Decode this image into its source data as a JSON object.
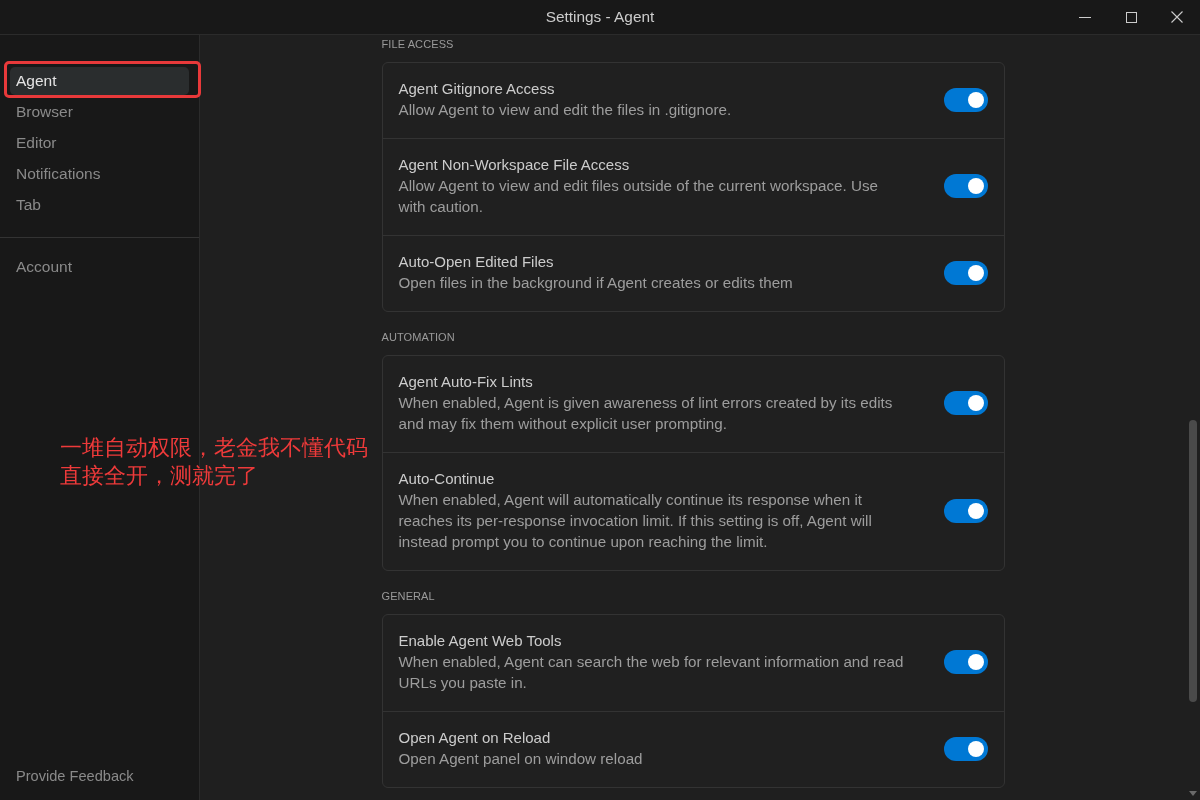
{
  "window": {
    "title": "Settings - Agent"
  },
  "sidebar": {
    "items": [
      {
        "label": "Agent",
        "selected": true,
        "circled": true
      },
      {
        "label": "Browser",
        "selected": false,
        "circled": false
      },
      {
        "label": "Editor",
        "selected": false,
        "circled": false
      },
      {
        "label": "Notifications",
        "selected": false,
        "circled": false
      },
      {
        "label": "Tab",
        "selected": false,
        "circled": false
      }
    ],
    "secondary_items": [
      {
        "label": "Account",
        "selected": false,
        "circled": false
      }
    ],
    "footer_link": "Provide Feedback"
  },
  "sections": [
    {
      "heading": "FILE ACCESS",
      "settings": [
        {
          "title": "Agent Gitignore Access",
          "description": "Allow Agent to view and edit the files in .gitignore.",
          "on": true
        },
        {
          "title": "Agent Non-Workspace File Access",
          "description": "Allow Agent to view and edit files outside of the current workspace. Use with caution.",
          "on": true
        },
        {
          "title": "Auto-Open Edited Files",
          "description": "Open files in the background if Agent creates or edits them",
          "on": true
        }
      ]
    },
    {
      "heading": "AUTOMATION",
      "settings": [
        {
          "title": "Agent Auto-Fix Lints",
          "description": "When enabled, Agent is given awareness of lint errors created by its edits and may fix them without explicit user prompting.",
          "on": true
        },
        {
          "title": "Auto-Continue",
          "description": "When enabled, Agent will automatically continue its response when it reaches its per-response invocation limit. If this setting is off, Agent will instead prompt you to continue upon reaching the limit.",
          "on": true
        }
      ]
    },
    {
      "heading": "GENERAL",
      "settings": [
        {
          "title": "Enable Agent Web Tools",
          "description": "When enabled, Agent can search the web for relevant information and read URLs you paste in.",
          "on": true
        },
        {
          "title": "Open Agent on Reload",
          "description": "Open Agent panel on window reload",
          "on": true
        }
      ]
    }
  ],
  "annotation": {
    "lines": [
      "一堆自动权限，老金我不懂代码",
      "直接全开，测就完了"
    ]
  }
}
